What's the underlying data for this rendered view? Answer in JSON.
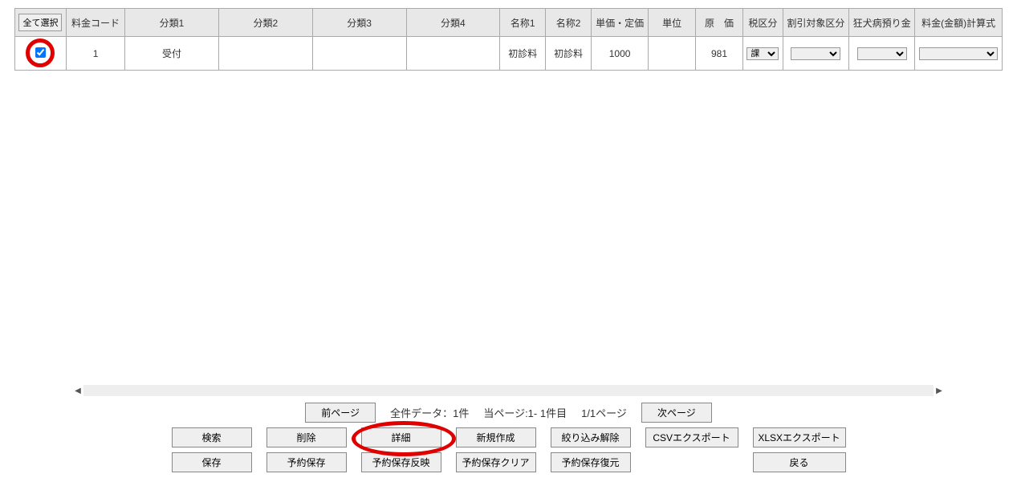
{
  "table": {
    "headers": {
      "select_all": "全て選択",
      "fee_code": "料金コード",
      "cat1": "分類1",
      "cat2": "分類2",
      "cat3": "分類3",
      "cat4": "分類4",
      "name1": "名称1",
      "name2": "名称2",
      "unit_price": "単価・定価",
      "unit": "単位",
      "cost": "原　価",
      "tax_type": "税区分",
      "discount_type": "割引対象区分",
      "rabies_deposit": "狂犬病預り金",
      "fee_formula": "料金(金額)計算式"
    },
    "rows": [
      {
        "checked": true,
        "fee_code": "1",
        "cat1": "受付",
        "cat2": "",
        "cat3": "",
        "cat4": "",
        "name1": "初診料",
        "name2": "初診料",
        "unit_price": "1000",
        "unit": "",
        "cost": "981",
        "tax_type": "課",
        "discount_type": "",
        "rabies_deposit": "",
        "fee_formula": ""
      }
    ]
  },
  "paging": {
    "prev": "前ページ",
    "next": "次ページ",
    "total": "全件データ：1件",
    "current_range": "当ページ:1- 1件目",
    "page_of": "1/1ページ"
  },
  "buttons": {
    "search": "検索",
    "delete": "削除",
    "detail": "詳細",
    "new": "新規作成",
    "clear_filter": "絞り込み解除",
    "csv": "CSVエクスポート",
    "xlsx": "XLSXエクスポート",
    "save": "保存",
    "reserve_save": "予約保存",
    "reserve_apply": "予約保存反映",
    "reserve_clear": "予約保存クリア",
    "reserve_restore": "予約保存復元",
    "back": "戻る"
  }
}
